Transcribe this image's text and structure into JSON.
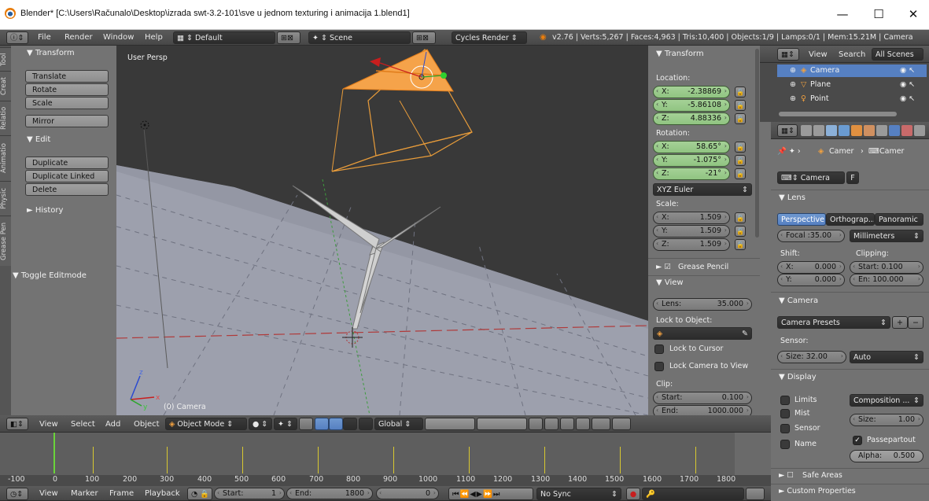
{
  "window": {
    "title": "Blender* [C:\\Users\\Računalo\\Desktop\\izrada swt-3.2-101\\sve u jednom texturing i animacija 1.blend1]",
    "minimize": "—",
    "maximize": "☐",
    "close": "✕"
  },
  "info_header": {
    "menus": [
      "File",
      "Render",
      "Window",
      "Help"
    ],
    "layout": "Default",
    "scene": "Scene",
    "engine": "Cycles Render",
    "stats": "v2.76 | Verts:5,267 | Faces:4,963 | Tris:10,400 | Objects:1/9 | Lamps:0/1 | Mem:15.21M | Camera"
  },
  "tool_tabs": [
    "Tool",
    "Creat",
    "Relatio",
    "Animatio",
    "Physic",
    "Grease Pen"
  ],
  "toolshelf": {
    "transform_title": "▼ Transform",
    "translate": "Translate",
    "rotate": "Rotate",
    "scale": "Scale",
    "mirror": "Mirror",
    "edit_title": "▼ Edit",
    "duplicate": "Duplicate",
    "duplicate_linked": "Duplicate Linked",
    "delete": "Delete",
    "history_title": "► History",
    "toggle_editmode": "▼ Toggle Editmode"
  },
  "viewport": {
    "view_label": "User Persp",
    "object_label": "(0) Camera"
  },
  "n_panel": {
    "transform_title": "▼ Transform",
    "location_label": "Location:",
    "location": [
      {
        "k": "X:",
        "v": "-2.38869"
      },
      {
        "k": "Y:",
        "v": "-5.86108"
      },
      {
        "k": "Z:",
        "v": "4.88336"
      }
    ],
    "rotation_label": "Rotation:",
    "rotation": [
      {
        "k": "X:",
        "v": "58.65°"
      },
      {
        "k": "Y:",
        "v": "-1.075°"
      },
      {
        "k": "Z:",
        "v": "-21°"
      }
    ],
    "rotation_mode": "XYZ Euler",
    "scale_label": "Scale:",
    "scale": [
      {
        "k": "X:",
        "v": "1.509"
      },
      {
        "k": "Y:",
        "v": "1.509"
      },
      {
        "k": "Z:",
        "v": "1.509"
      }
    ],
    "grease_pencil": "Grease Pencil",
    "view_title": "▼ View",
    "lens_k": "Lens:",
    "lens_v": "35.000",
    "lock_to_object": "Lock to Object:",
    "lock_to_cursor": "Lock to Cursor",
    "lock_camera_to_view": "Lock Camera to View",
    "clip_label": "Clip:",
    "clip_start_k": "Start:",
    "clip_start_v": "0.100",
    "clip_end_k": "End:",
    "clip_end_v": "1000.000"
  },
  "outliner": {
    "view": "View",
    "search": "Search",
    "filter": "All Scenes",
    "items": [
      "Camera",
      "Plane",
      "Point"
    ]
  },
  "properties": {
    "breadcrumb_1": "Camer",
    "breadcrumb_2": "Camer",
    "datablock": "Camera",
    "fake_user": "F",
    "lens_title": "▼ Lens",
    "perspective": "Perspective",
    "orthographic": "Orthograp...",
    "panoramic": "Panoramic",
    "focal": "Focal :35.00",
    "units": "Millimeters",
    "shift_label": "Shift:",
    "clipping_label": "Clipping:",
    "shift_x_k": "X:",
    "shift_x_v": "0.000",
    "shift_y_k": "Y:",
    "shift_y_v": "0.000",
    "clip_start": "Start: 0.100",
    "clip_end": "En: 100.000",
    "camera_title": "▼ Camera",
    "camera_presets": "Camera Presets",
    "sensor_label": "Sensor:",
    "sensor_size": "Size: 32.00",
    "sensor_fit": "Auto",
    "display_title": "▼ Display",
    "limits": "Limits",
    "mist": "Mist",
    "sensor": "Sensor",
    "name": "Name",
    "composition": "Composition ...",
    "size": "Size:",
    "size_v": "1.00",
    "passepartout": "Passepartout",
    "alpha": "Alpha:",
    "alpha_v": "0.500",
    "safe_areas": "Safe Areas",
    "custom_properties": "► Custom Properties"
  },
  "view3d_header": {
    "view": "View",
    "select": "Select",
    "add": "Add",
    "object": "Object",
    "mode": "Object Mode",
    "orientation": "Global"
  },
  "timeline": {
    "ruler": [
      "-100",
      "0",
      "100",
      "200",
      "300",
      "400",
      "500",
      "600",
      "700",
      "800",
      "900",
      "1000",
      "1100",
      "1200",
      "1300",
      "1400",
      "1500",
      "1600",
      "1700",
      "1800"
    ],
    "view": "View",
    "marker": "Marker",
    "frame": "Frame",
    "playback": "Playback",
    "start_k": "Start:",
    "start_v": "1",
    "end_k": "End:",
    "end_v": "1800",
    "current": "0",
    "sync": "No Sync"
  }
}
